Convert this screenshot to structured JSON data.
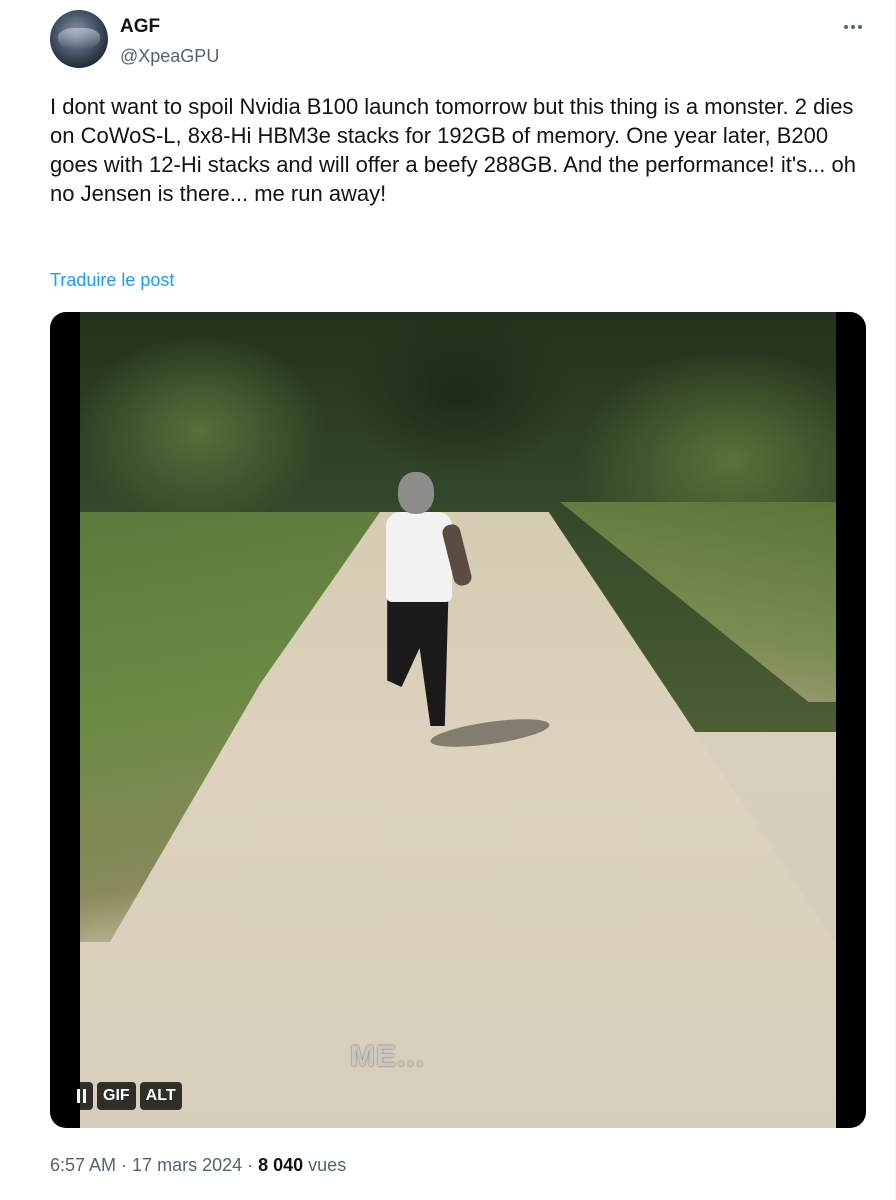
{
  "author": {
    "name": "AGF",
    "handle": "@XpeaGPU",
    "avatar_icon": "profile-photo"
  },
  "post": {
    "text": "I dont want to spoil Nvidia B100 launch tomorrow but this thing is a monster. 2 dies on CoWoS-L, 8x8-Hi HBM3e stacks for 192GB of memory. One year later, B200 goes with 12-Hi stacks and will offer a beefy 288GB. And the performance! it's... oh no Jensen is there... me run away!",
    "translate_label": "Traduire le post",
    "more_icon": "more-horizontal-icon"
  },
  "media": {
    "caption": "ME...",
    "gif_label": "GIF",
    "alt_label": "ALT",
    "pause_icon": "pause-icon"
  },
  "meta": {
    "time": "6:57 AM",
    "sep1": " · ",
    "date": "17 mars 2024",
    "sep2": " · ",
    "views": "8 040",
    "views_label": " vues"
  },
  "colors": {
    "link": "#1d9bf0",
    "text": "#0f1419",
    "secondary": "#536471"
  }
}
